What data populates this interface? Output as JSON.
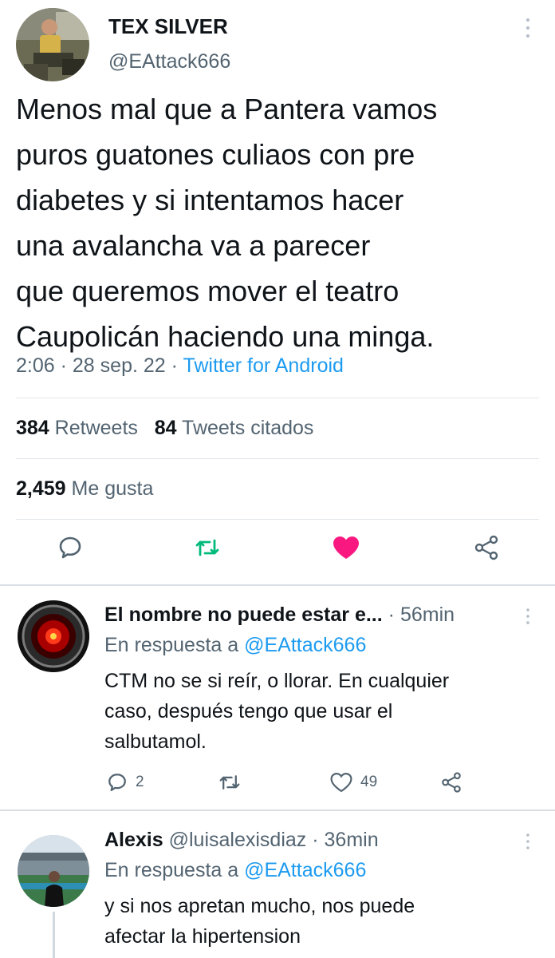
{
  "tweet": {
    "display_name": "TEX SILVER",
    "handle": "@EAttack666",
    "text_lines": [
      "Menos mal que a Pantera vamos",
      "puros guatones culiaos con pre",
      "diabetes y si intentamos hacer",
      "una avalancha va a parecer",
      "que queremos mover el teatro",
      "Caupolicán haciendo una minga."
    ],
    "time": "2:06",
    "date": "28 sep. 22",
    "separator": "·",
    "source": "Twitter for Android",
    "retweets_count": "384",
    "retweets_label": "Retweets",
    "quotes_count": "84",
    "quotes_label": "Tweets citados",
    "likes_count": "2,459",
    "likes_label": "Me gusta",
    "liked": true,
    "colors": {
      "like": "#f91880",
      "retweet": "#00ba7c",
      "link": "#1d9bf0",
      "secondary": "#536471"
    }
  },
  "replies": [
    {
      "name": "El nombre no puede estar e...",
      "handle": "",
      "separator": "·",
      "time": "56min",
      "reply_prefix": "En respuesta a",
      "reply_to": "@EAttack666",
      "text_lines": [
        "CTM no se si reír,  o llorar. En cualquier",
        "caso, después tengo que usar el",
        "salbutamol."
      ],
      "replies_count": "2",
      "retweets_count": "",
      "likes_count": "49",
      "avatar": "hal9000-eye"
    },
    {
      "name": "Alexis",
      "handle": "@luisalexisdiaz",
      "separator": "·",
      "time": "36min",
      "reply_prefix": "En respuesta a",
      "reply_to": "@EAttack666",
      "text_lines": [
        "y si nos apretan mucho, nos puede",
        "afectar la hipertension"
      ],
      "avatar": "person-stadium"
    }
  ],
  "icons": {
    "reply": "reply-icon",
    "retweet": "retweet-icon",
    "like": "heart-icon",
    "share": "share-icon",
    "more": "more-icon"
  }
}
